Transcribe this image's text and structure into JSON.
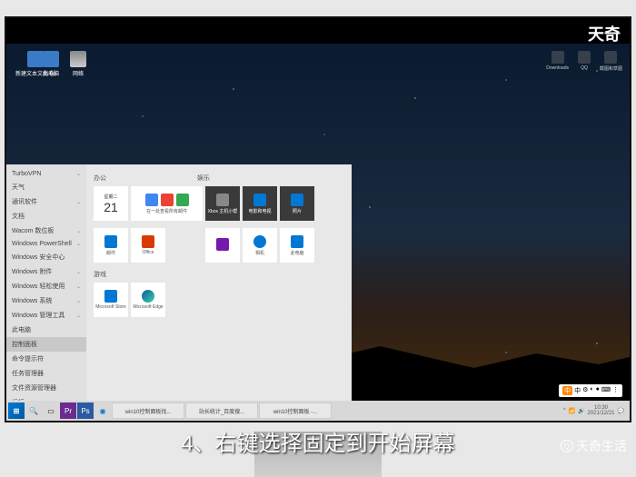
{
  "watermark": "天奇",
  "brand": "天奇生活",
  "caption": "4、右键选择固定到开始屏幕",
  "desktop_icons": [
    {
      "label": "新建文本文档.txt"
    },
    {
      "label": "此电脑"
    },
    {
      "label": "网络"
    }
  ],
  "tray_icons": [
    {
      "label": "Downloads"
    },
    {
      "label": "QQ"
    },
    {
      "label": "截图和草图"
    }
  ],
  "start": {
    "left_items": [
      "TurboVPN",
      "天气",
      "通讯软件",
      "文档",
      "Wacom 数位板",
      "Windows PowerShell",
      "Windows 安全中心",
      "Windows 附件",
      "Windows 轻松使用",
      "Windows 系统",
      "Windows 管理工具",
      "此电脑",
      "控制面板",
      "命令提示符",
      "任务管理器",
      "文件资源管理器",
      "运行"
    ],
    "sections": {
      "a": "办公",
      "b": "娱乐",
      "c": "游戏"
    },
    "calendar": {
      "dow": "星期二",
      "num": "21"
    },
    "tiles": {
      "googlesuite": "在一处查看所有邮件",
      "xbox": "Xbox 主机小帮",
      "movies": "电影和电视",
      "photos": "照片",
      "mail": "邮件",
      "office": "Office",
      "onenote": "",
      "camera": "相机",
      "pc": "此电脑",
      "msstore": "Microsoft Store",
      "edge": "Microsoft Edge"
    }
  },
  "taskbar": {
    "tasks": [
      "win10控制面板找...",
      "站长统计_百度搜...",
      "win10控制面板 -..."
    ],
    "time": "10:30",
    "date": "2021/12/21"
  },
  "lang_bar": {
    "indicator": "中",
    "items": [
      "中",
      "⚙",
      "◐",
      "●",
      "⌨",
      "⋮"
    ]
  }
}
